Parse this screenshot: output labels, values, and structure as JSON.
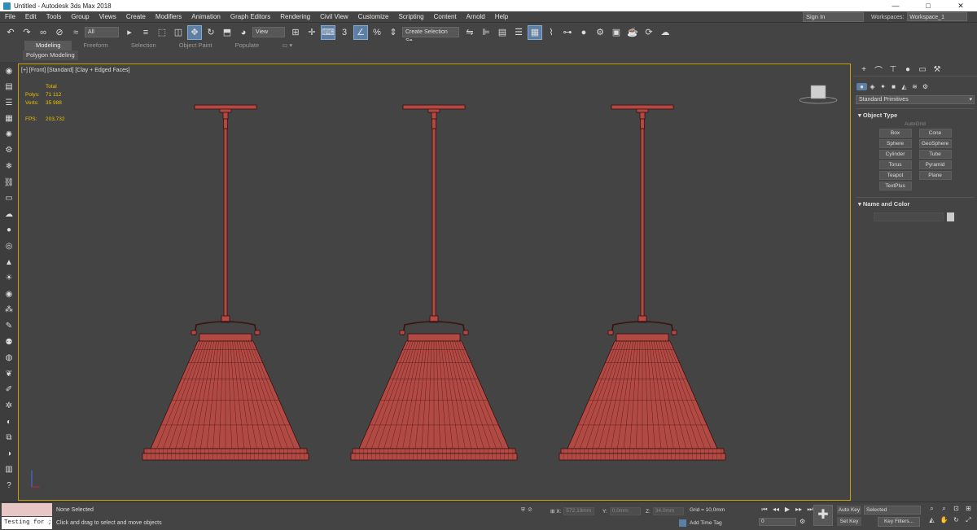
{
  "window": {
    "title": "Untitled - Autodesk 3ds Max 2018",
    "controls": [
      "—",
      "□",
      "✕"
    ]
  },
  "menu": [
    "File",
    "Edit",
    "Tools",
    "Group",
    "Views",
    "Create",
    "Modifiers",
    "Animation",
    "Graph Editors",
    "Rendering",
    "Civil View",
    "Customize",
    "Scripting",
    "Content",
    "Arnold",
    "Help"
  ],
  "account": {
    "signin": "Sign In",
    "workspaces_label": "Workspaces:",
    "workspace_value": "Workspace_1"
  },
  "toolbar": {
    "filter_value": "All",
    "view_value": "View",
    "selection_set": "Create Selection Se"
  },
  "ribbon": {
    "tabs": [
      "Modeling",
      "Freeform",
      "Selection",
      "Object Paint",
      "Populate"
    ],
    "active_tab": "Modeling",
    "sub_label": "Polygon Modeling"
  },
  "viewport": {
    "label": "[+] [Front] [Standard] [Clay + Edged Faces]",
    "stats_header": "Total",
    "polys_label": "Polys:",
    "polys_value": "71 112",
    "verts_label": "Verts:",
    "verts_value": "35 988",
    "fps_label": "FPS:",
    "fps_value": "203,732",
    "lamp_color": "#b24a44",
    "wire_color": "#3a1010"
  },
  "command_panel": {
    "category": "Standard Primitives",
    "object_type_title": "Object Type",
    "autogrid": "AutoGrid",
    "buttons": [
      "Box",
      "Cone",
      "Sphere",
      "GeoSphere",
      "Cylinder",
      "Tube",
      "Torus",
      "Pyramid",
      "Teapot",
      "Plane",
      "TextPlus"
    ],
    "name_color_title": "Name and Color"
  },
  "status": {
    "maxscript_text": "Testing for ;",
    "selection": "None Selected",
    "prompt": "Click and drag to select and move objects",
    "x_label": "X:",
    "x_value": "572,19mm",
    "y_label": "Y:",
    "y_value": "0,0mm",
    "z_label": "Z:",
    "z_value": "34,0mm",
    "grid": "Grid = 10,0mm",
    "add_time_tag": "Add Time Tag",
    "frame": "0",
    "auto_key": "Auto Key",
    "set_key": "Set Key",
    "selected": "Selected",
    "key_filters": "Key Filters..."
  }
}
